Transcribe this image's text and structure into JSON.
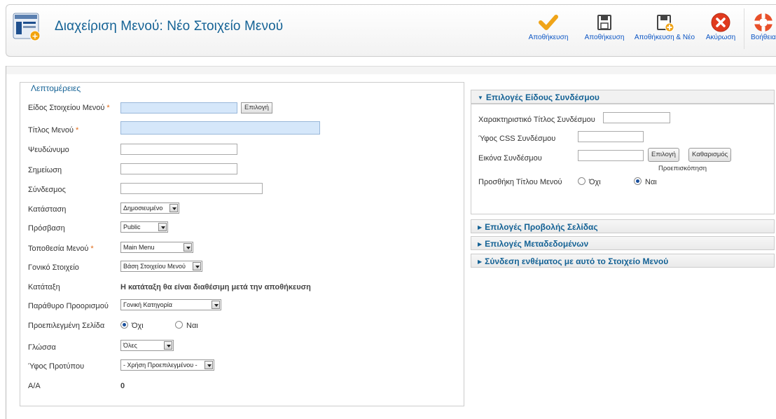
{
  "header": {
    "title": "Διαχείριση Μενού: Νέο Στοιχείο Μενού",
    "icon": "menu-item-new-icon"
  },
  "toolbar": {
    "save": {
      "label": "Αποθήκευση",
      "icon": "checkmark-icon"
    },
    "save_close": {
      "label": "Αποθήκευση",
      "icon": "floppy-icon"
    },
    "save_new": {
      "label": "Αποθήκευση & Νέο",
      "icon": "floppy-new-icon"
    },
    "cancel": {
      "label": "Ακύρωση",
      "icon": "cancel-icon"
    },
    "help": {
      "label": "Βοήθεια",
      "icon": "lifebuoy-icon"
    }
  },
  "details": {
    "legend": "Λεπτομέρειες",
    "fields": {
      "type_label": "Είδος Στοιχείου Μενού",
      "type_value": "",
      "select_button": "Επιλογή",
      "title_label": "Τίτλος Μενού",
      "title_value": "",
      "alias_label": "Ψευδώνυμο",
      "alias_value": "",
      "note_label": "Σημείωση",
      "note_value": "",
      "link_label": "Σύνδεσμος",
      "link_value": "",
      "status_label": "Κατάσταση",
      "status_value": "Δημοσιευμένο",
      "access_label": "Πρόσβαση",
      "access_value": "Public",
      "menu_location_label": "Τοποθεσία Μενού",
      "menu_location_value": "Main Menu",
      "parent_label": "Γονικό Στοιχείο",
      "parent_value": "Βάση Στοιχείου Μενού",
      "ordering_label": "Κατάταξη",
      "ordering_value": "Η κατάταξη θα είναι διαθέσιμη μετά την αποθήκευση",
      "target_window_label": "Παράθυρο Προορισμού",
      "target_window_value": "Γονική Κατηγορία",
      "default_page_label": "Προεπιλεγμένη Σελίδα",
      "default_no": "Όχι",
      "default_yes": "Ναι",
      "default_selected": "no",
      "language_label": "Γλώσσα",
      "language_value": "Όλες",
      "template_style_label": "Ύφος Προτύπου",
      "template_style_value": "- Χρήση Προεπιλεγμένου -",
      "id_label": "Α/Α",
      "id_value": "0"
    }
  },
  "link_options": {
    "title": "Επιλογές Είδους Συνδέσμου",
    "title_attr_label": "Χαρακτηριστικό Τίτλος Συνδέσμου",
    "title_attr_value": "",
    "css_label": "Ύφος CSS Συνδέσμου",
    "css_value": "",
    "image_label": "Εικόνα Συνδέσμου",
    "image_value": "",
    "image_select": "Επιλογή",
    "image_clear": "Καθαρισμός",
    "image_preview": "Προεπισκόπηση",
    "add_title_label": "Προσθήκη Τίτλου Μενού",
    "add_title_no": "Όχι",
    "add_title_yes": "Ναι",
    "add_title_selected": "yes"
  },
  "collapsed_panels": [
    "Επιλογές Προβολής Σελίδας",
    "Επιλογές Μεταδεδομένων",
    "Σύνδεση ενθέματος με αυτό το Στοιχείο Μενού"
  ]
}
